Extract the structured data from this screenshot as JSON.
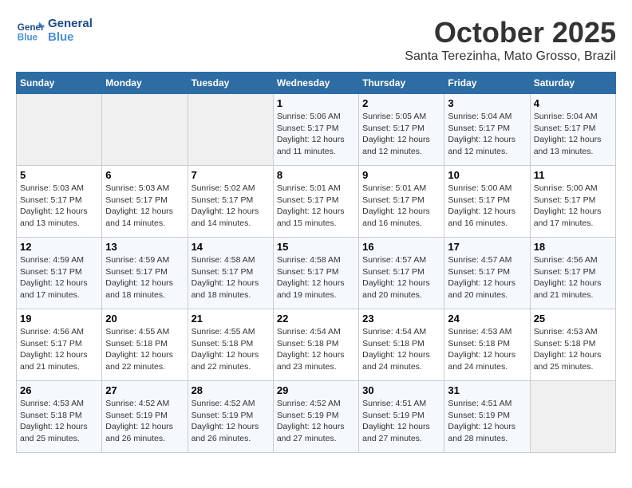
{
  "header": {
    "logo_line1": "General",
    "logo_line2": "Blue",
    "month": "October 2025",
    "location": "Santa Terezinha, Mato Grosso, Brazil"
  },
  "weekdays": [
    "Sunday",
    "Monday",
    "Tuesday",
    "Wednesday",
    "Thursday",
    "Friday",
    "Saturday"
  ],
  "weeks": [
    [
      {
        "day": "",
        "info": ""
      },
      {
        "day": "",
        "info": ""
      },
      {
        "day": "",
        "info": ""
      },
      {
        "day": "1",
        "info": "Sunrise: 5:06 AM\nSunset: 5:17 PM\nDaylight: 12 hours\nand 11 minutes."
      },
      {
        "day": "2",
        "info": "Sunrise: 5:05 AM\nSunset: 5:17 PM\nDaylight: 12 hours\nand 12 minutes."
      },
      {
        "day": "3",
        "info": "Sunrise: 5:04 AM\nSunset: 5:17 PM\nDaylight: 12 hours\nand 12 minutes."
      },
      {
        "day": "4",
        "info": "Sunrise: 5:04 AM\nSunset: 5:17 PM\nDaylight: 12 hours\nand 13 minutes."
      }
    ],
    [
      {
        "day": "5",
        "info": "Sunrise: 5:03 AM\nSunset: 5:17 PM\nDaylight: 12 hours\nand 13 minutes."
      },
      {
        "day": "6",
        "info": "Sunrise: 5:03 AM\nSunset: 5:17 PM\nDaylight: 12 hours\nand 14 minutes."
      },
      {
        "day": "7",
        "info": "Sunrise: 5:02 AM\nSunset: 5:17 PM\nDaylight: 12 hours\nand 14 minutes."
      },
      {
        "day": "8",
        "info": "Sunrise: 5:01 AM\nSunset: 5:17 PM\nDaylight: 12 hours\nand 15 minutes."
      },
      {
        "day": "9",
        "info": "Sunrise: 5:01 AM\nSunset: 5:17 PM\nDaylight: 12 hours\nand 16 minutes."
      },
      {
        "day": "10",
        "info": "Sunrise: 5:00 AM\nSunset: 5:17 PM\nDaylight: 12 hours\nand 16 minutes."
      },
      {
        "day": "11",
        "info": "Sunrise: 5:00 AM\nSunset: 5:17 PM\nDaylight: 12 hours\nand 17 minutes."
      }
    ],
    [
      {
        "day": "12",
        "info": "Sunrise: 4:59 AM\nSunset: 5:17 PM\nDaylight: 12 hours\nand 17 minutes."
      },
      {
        "day": "13",
        "info": "Sunrise: 4:59 AM\nSunset: 5:17 PM\nDaylight: 12 hours\nand 18 minutes."
      },
      {
        "day": "14",
        "info": "Sunrise: 4:58 AM\nSunset: 5:17 PM\nDaylight: 12 hours\nand 18 minutes."
      },
      {
        "day": "15",
        "info": "Sunrise: 4:58 AM\nSunset: 5:17 PM\nDaylight: 12 hours\nand 19 minutes."
      },
      {
        "day": "16",
        "info": "Sunrise: 4:57 AM\nSunset: 5:17 PM\nDaylight: 12 hours\nand 20 minutes."
      },
      {
        "day": "17",
        "info": "Sunrise: 4:57 AM\nSunset: 5:17 PM\nDaylight: 12 hours\nand 20 minutes."
      },
      {
        "day": "18",
        "info": "Sunrise: 4:56 AM\nSunset: 5:17 PM\nDaylight: 12 hours\nand 21 minutes."
      }
    ],
    [
      {
        "day": "19",
        "info": "Sunrise: 4:56 AM\nSunset: 5:17 PM\nDaylight: 12 hours\nand 21 minutes."
      },
      {
        "day": "20",
        "info": "Sunrise: 4:55 AM\nSunset: 5:18 PM\nDaylight: 12 hours\nand 22 minutes."
      },
      {
        "day": "21",
        "info": "Sunrise: 4:55 AM\nSunset: 5:18 PM\nDaylight: 12 hours\nand 22 minutes."
      },
      {
        "day": "22",
        "info": "Sunrise: 4:54 AM\nSunset: 5:18 PM\nDaylight: 12 hours\nand 23 minutes."
      },
      {
        "day": "23",
        "info": "Sunrise: 4:54 AM\nSunset: 5:18 PM\nDaylight: 12 hours\nand 24 minutes."
      },
      {
        "day": "24",
        "info": "Sunrise: 4:53 AM\nSunset: 5:18 PM\nDaylight: 12 hours\nand 24 minutes."
      },
      {
        "day": "25",
        "info": "Sunrise: 4:53 AM\nSunset: 5:18 PM\nDaylight: 12 hours\nand 25 minutes."
      }
    ],
    [
      {
        "day": "26",
        "info": "Sunrise: 4:53 AM\nSunset: 5:18 PM\nDaylight: 12 hours\nand 25 minutes."
      },
      {
        "day": "27",
        "info": "Sunrise: 4:52 AM\nSunset: 5:19 PM\nDaylight: 12 hours\nand 26 minutes."
      },
      {
        "day": "28",
        "info": "Sunrise: 4:52 AM\nSunset: 5:19 PM\nDaylight: 12 hours\nand 26 minutes."
      },
      {
        "day": "29",
        "info": "Sunrise: 4:52 AM\nSunset: 5:19 PM\nDaylight: 12 hours\nand 27 minutes."
      },
      {
        "day": "30",
        "info": "Sunrise: 4:51 AM\nSunset: 5:19 PM\nDaylight: 12 hours\nand 27 minutes."
      },
      {
        "day": "31",
        "info": "Sunrise: 4:51 AM\nSunset: 5:19 PM\nDaylight: 12 hours\nand 28 minutes."
      },
      {
        "day": "",
        "info": ""
      }
    ]
  ]
}
